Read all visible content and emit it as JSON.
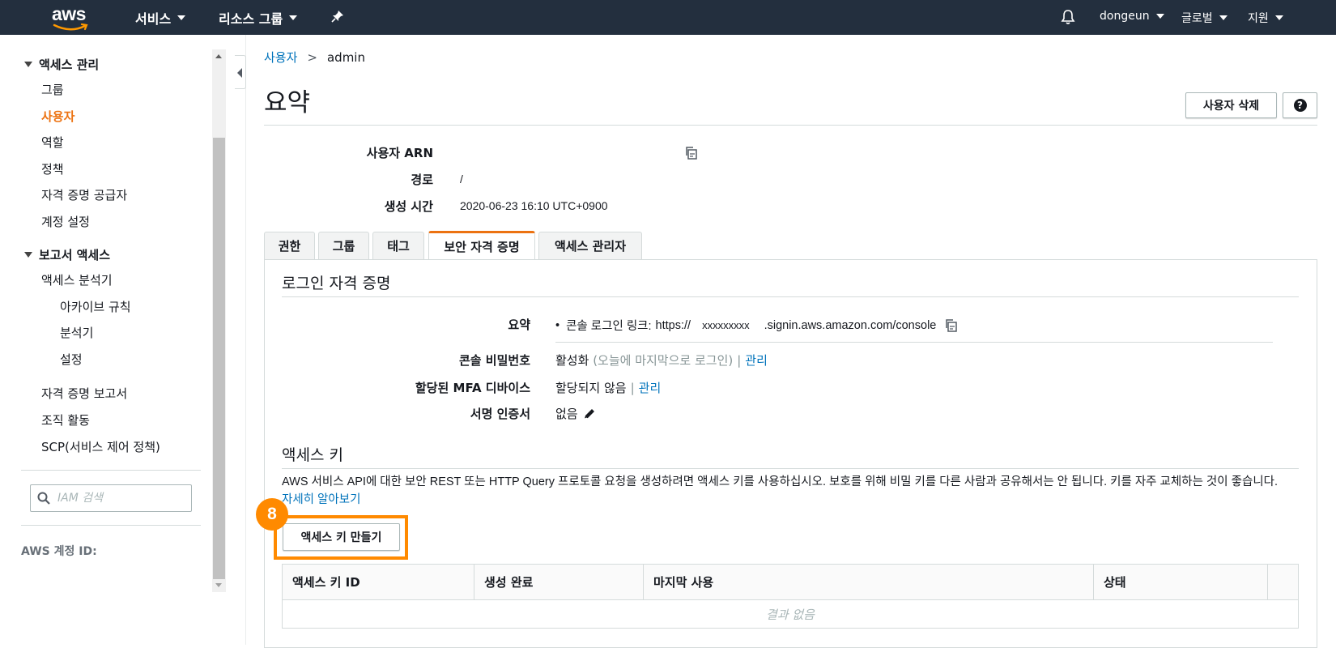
{
  "topnav": {
    "logo": "aws",
    "services": "서비스",
    "resource_groups": "리소스 그룹",
    "user": "dongeun",
    "region": "글로벌",
    "support": "지원",
    "icons": [
      "pin-icon",
      "bell-icon"
    ]
  },
  "sidebar": {
    "section_access": "액세스 관리",
    "items_access": [
      "그룹",
      "사용자",
      "역할",
      "정책",
      "자격 증명 공급자",
      "계정 설정"
    ],
    "section_report": "보고서 액세스",
    "items_report": [
      "액세스 분석기",
      "아카이브 규칙",
      "분석기",
      "설정",
      "자격 증명 보고서",
      "조직 활동",
      "SCP(서비스 제어 정책)"
    ],
    "search_placeholder": "IAM 검색",
    "account_id_label": "AWS 계정 ID:"
  },
  "breadcrumb": {
    "parent": "사용자",
    "sep": ">",
    "current": "admin"
  },
  "title": "요약",
  "buttons": {
    "delete_user": "사용자 삭제",
    "help": "?"
  },
  "summary": {
    "arn_label": "사용자 ARN",
    "path_label": "경로",
    "path_value": "/",
    "created_label": "생성 시간",
    "created_value": "2020-06-23 16:10 UTC+0900"
  },
  "tabs": [
    "권한",
    "그룹",
    "태그",
    "보안 자격 증명",
    "액세스 관리자"
  ],
  "active_tab": "보안 자격 증명",
  "signin": {
    "title": "로그인 자격 증명",
    "summary_label": "요약",
    "console_link_prefix": "콘솔 로그인 링크:",
    "console_link_url_a": "https://",
    "console_link_account": "xxxxxxxxx",
    "console_link_url_b": ".signin.aws.amazon.com/console",
    "password_label": "콘솔 비밀번호",
    "password_value": "활성화",
    "password_note": "(오늘에 마지막으로 로그인)",
    "manage": "관리",
    "mfa_label": "할당된 MFA 디바이스",
    "mfa_value": "할당되지 않음",
    "cert_label": "서명 인증서",
    "cert_value": "없음"
  },
  "access_keys": {
    "title": "액세스 키",
    "description": "AWS 서비스 API에 대한 보안 REST 또는 HTTP Query 프로토콜 요청을 생성하려면 액세스 키를 사용하십시오. 보호를 위해 비밀 키를 다른 사람과 공유해서는 안 됩니다. 키를 자주 교체하는 것이 좋습니다.",
    "learn_more": "자세히 알아보기",
    "create_button": "액세스 키 만들기",
    "step_badge": "8",
    "columns": [
      "액세스 키 ID",
      "생성 완료",
      "마지막 사용",
      "상태",
      ""
    ],
    "empty_text": "결과 없음"
  },
  "colors": {
    "nav_bg": "#232f3e",
    "accent": "#ec7211",
    "link": "#0073bb",
    "highlight": "#ff8a00"
  }
}
